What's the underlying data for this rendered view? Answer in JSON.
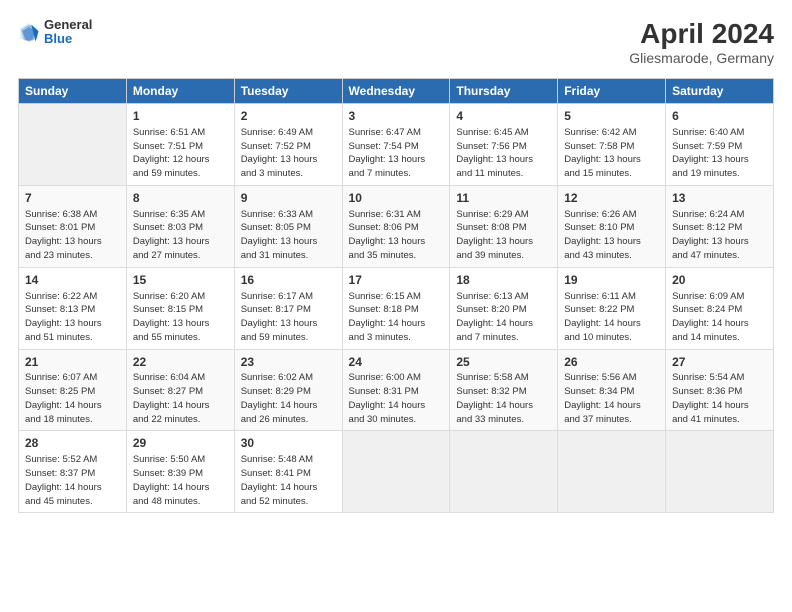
{
  "header": {
    "logo_general": "General",
    "logo_blue": "Blue",
    "title": "April 2024",
    "subtitle": "Gliesmarode, Germany"
  },
  "days_of_week": [
    "Sunday",
    "Monday",
    "Tuesday",
    "Wednesday",
    "Thursday",
    "Friday",
    "Saturday"
  ],
  "weeks": [
    [
      {
        "day": "",
        "sunrise": "",
        "sunset": "",
        "daylight": ""
      },
      {
        "day": "1",
        "sunrise": "Sunrise: 6:51 AM",
        "sunset": "Sunset: 7:51 PM",
        "daylight": "Daylight: 12 hours and 59 minutes."
      },
      {
        "day": "2",
        "sunrise": "Sunrise: 6:49 AM",
        "sunset": "Sunset: 7:52 PM",
        "daylight": "Daylight: 13 hours and 3 minutes."
      },
      {
        "day": "3",
        "sunrise": "Sunrise: 6:47 AM",
        "sunset": "Sunset: 7:54 PM",
        "daylight": "Daylight: 13 hours and 7 minutes."
      },
      {
        "day": "4",
        "sunrise": "Sunrise: 6:45 AM",
        "sunset": "Sunset: 7:56 PM",
        "daylight": "Daylight: 13 hours and 11 minutes."
      },
      {
        "day": "5",
        "sunrise": "Sunrise: 6:42 AM",
        "sunset": "Sunset: 7:58 PM",
        "daylight": "Daylight: 13 hours and 15 minutes."
      },
      {
        "day": "6",
        "sunrise": "Sunrise: 6:40 AM",
        "sunset": "Sunset: 7:59 PM",
        "daylight": "Daylight: 13 hours and 19 minutes."
      }
    ],
    [
      {
        "day": "7",
        "sunrise": "Sunrise: 6:38 AM",
        "sunset": "Sunset: 8:01 PM",
        "daylight": "Daylight: 13 hours and 23 minutes."
      },
      {
        "day": "8",
        "sunrise": "Sunrise: 6:35 AM",
        "sunset": "Sunset: 8:03 PM",
        "daylight": "Daylight: 13 hours and 27 minutes."
      },
      {
        "day": "9",
        "sunrise": "Sunrise: 6:33 AM",
        "sunset": "Sunset: 8:05 PM",
        "daylight": "Daylight: 13 hours and 31 minutes."
      },
      {
        "day": "10",
        "sunrise": "Sunrise: 6:31 AM",
        "sunset": "Sunset: 8:06 PM",
        "daylight": "Daylight: 13 hours and 35 minutes."
      },
      {
        "day": "11",
        "sunrise": "Sunrise: 6:29 AM",
        "sunset": "Sunset: 8:08 PM",
        "daylight": "Daylight: 13 hours and 39 minutes."
      },
      {
        "day": "12",
        "sunrise": "Sunrise: 6:26 AM",
        "sunset": "Sunset: 8:10 PM",
        "daylight": "Daylight: 13 hours and 43 minutes."
      },
      {
        "day": "13",
        "sunrise": "Sunrise: 6:24 AM",
        "sunset": "Sunset: 8:12 PM",
        "daylight": "Daylight: 13 hours and 47 minutes."
      }
    ],
    [
      {
        "day": "14",
        "sunrise": "Sunrise: 6:22 AM",
        "sunset": "Sunset: 8:13 PM",
        "daylight": "Daylight: 13 hours and 51 minutes."
      },
      {
        "day": "15",
        "sunrise": "Sunrise: 6:20 AM",
        "sunset": "Sunset: 8:15 PM",
        "daylight": "Daylight: 13 hours and 55 minutes."
      },
      {
        "day": "16",
        "sunrise": "Sunrise: 6:17 AM",
        "sunset": "Sunset: 8:17 PM",
        "daylight": "Daylight: 13 hours and 59 minutes."
      },
      {
        "day": "17",
        "sunrise": "Sunrise: 6:15 AM",
        "sunset": "Sunset: 8:18 PM",
        "daylight": "Daylight: 14 hours and 3 minutes."
      },
      {
        "day": "18",
        "sunrise": "Sunrise: 6:13 AM",
        "sunset": "Sunset: 8:20 PM",
        "daylight": "Daylight: 14 hours and 7 minutes."
      },
      {
        "day": "19",
        "sunrise": "Sunrise: 6:11 AM",
        "sunset": "Sunset: 8:22 PM",
        "daylight": "Daylight: 14 hours and 10 minutes."
      },
      {
        "day": "20",
        "sunrise": "Sunrise: 6:09 AM",
        "sunset": "Sunset: 8:24 PM",
        "daylight": "Daylight: 14 hours and 14 minutes."
      }
    ],
    [
      {
        "day": "21",
        "sunrise": "Sunrise: 6:07 AM",
        "sunset": "Sunset: 8:25 PM",
        "daylight": "Daylight: 14 hours and 18 minutes."
      },
      {
        "day": "22",
        "sunrise": "Sunrise: 6:04 AM",
        "sunset": "Sunset: 8:27 PM",
        "daylight": "Daylight: 14 hours and 22 minutes."
      },
      {
        "day": "23",
        "sunrise": "Sunrise: 6:02 AM",
        "sunset": "Sunset: 8:29 PM",
        "daylight": "Daylight: 14 hours and 26 minutes."
      },
      {
        "day": "24",
        "sunrise": "Sunrise: 6:00 AM",
        "sunset": "Sunset: 8:31 PM",
        "daylight": "Daylight: 14 hours and 30 minutes."
      },
      {
        "day": "25",
        "sunrise": "Sunrise: 5:58 AM",
        "sunset": "Sunset: 8:32 PM",
        "daylight": "Daylight: 14 hours and 33 minutes."
      },
      {
        "day": "26",
        "sunrise": "Sunrise: 5:56 AM",
        "sunset": "Sunset: 8:34 PM",
        "daylight": "Daylight: 14 hours and 37 minutes."
      },
      {
        "day": "27",
        "sunrise": "Sunrise: 5:54 AM",
        "sunset": "Sunset: 8:36 PM",
        "daylight": "Daylight: 14 hours and 41 minutes."
      }
    ],
    [
      {
        "day": "28",
        "sunrise": "Sunrise: 5:52 AM",
        "sunset": "Sunset: 8:37 PM",
        "daylight": "Daylight: 14 hours and 45 minutes."
      },
      {
        "day": "29",
        "sunrise": "Sunrise: 5:50 AM",
        "sunset": "Sunset: 8:39 PM",
        "daylight": "Daylight: 14 hours and 48 minutes."
      },
      {
        "day": "30",
        "sunrise": "Sunrise: 5:48 AM",
        "sunset": "Sunset: 8:41 PM",
        "daylight": "Daylight: 14 hours and 52 minutes."
      },
      {
        "day": "",
        "sunrise": "",
        "sunset": "",
        "daylight": ""
      },
      {
        "day": "",
        "sunrise": "",
        "sunset": "",
        "daylight": ""
      },
      {
        "day": "",
        "sunrise": "",
        "sunset": "",
        "daylight": ""
      },
      {
        "day": "",
        "sunrise": "",
        "sunset": "",
        "daylight": ""
      }
    ]
  ]
}
